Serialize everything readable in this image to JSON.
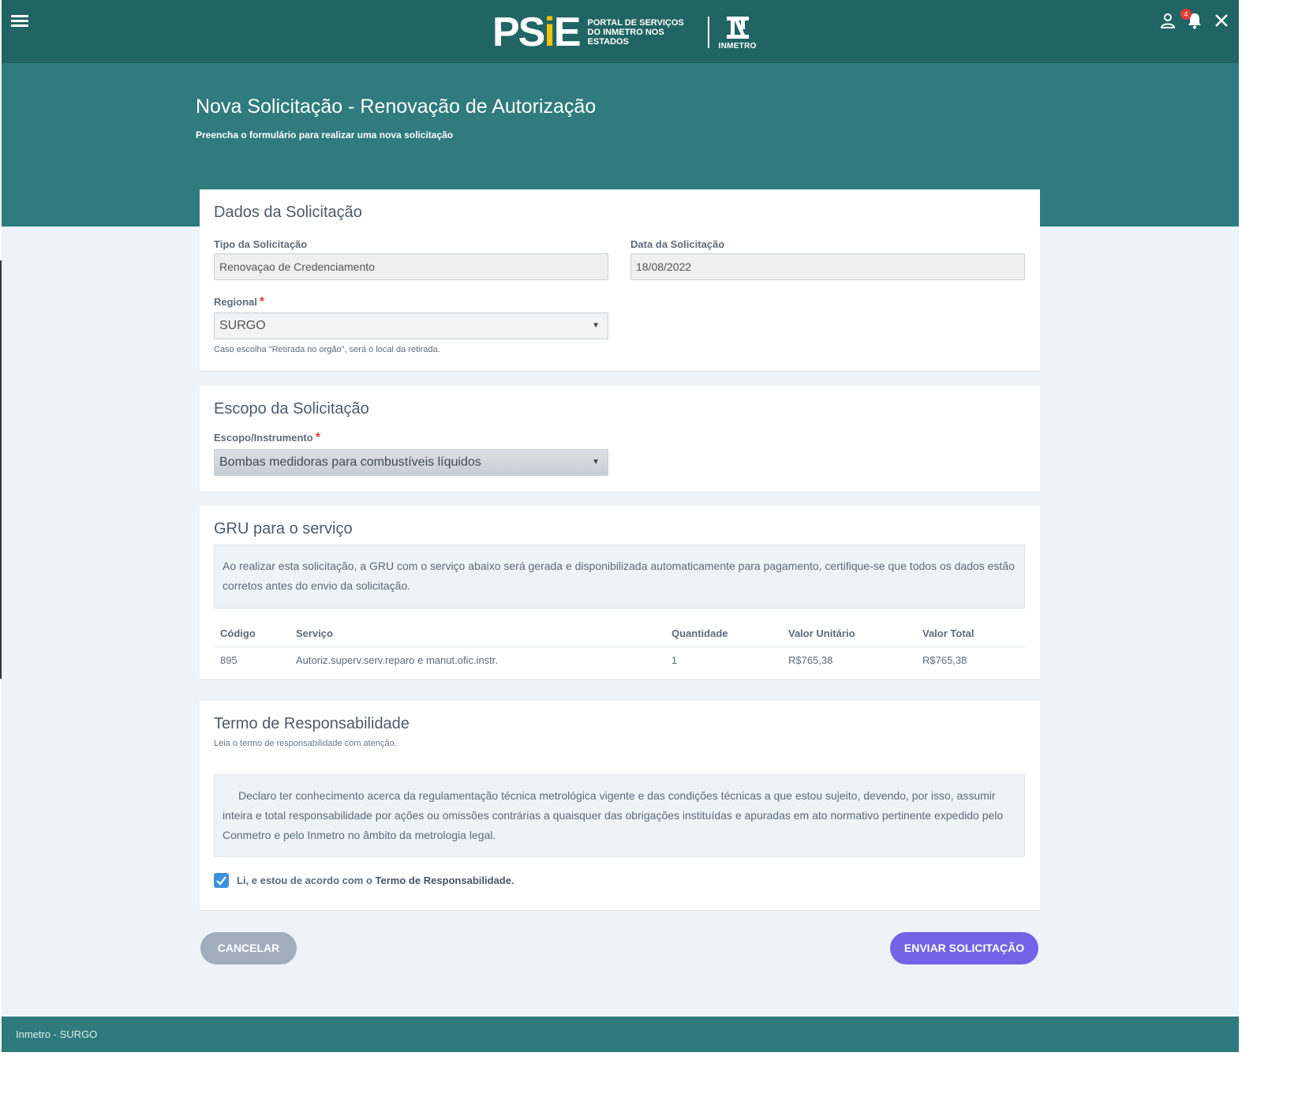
{
  "header": {
    "brand": {
      "ps": "PS",
      "s": "",
      "i": "i",
      "e": "E",
      "description_line1": "PORTAL DE SERVIÇOS",
      "description_line2": "DO INMETRO NOS ESTADOS",
      "inmetro": "INMETRO"
    },
    "icons": [
      "menu-icon",
      "user-icon",
      "bell-icon",
      "close-icon"
    ],
    "notification_count": "4"
  },
  "hero": {
    "title": "Nova Solicitação - Renovação de Autorização",
    "subtitle": "Preencha o formulário para realizar uma nova solicitação"
  },
  "dados": {
    "title": "Dados da Solicitação",
    "tipo_label": "Tipo da Solicitação",
    "tipo_value": "Renovaçao de Credenciamento",
    "data_label": "Data da Solicitação",
    "data_value": "18/08/2022",
    "regional_label": "Regional",
    "regional_required": "*",
    "regional_value": "SURGO",
    "regional_hint": "Caso escolha \"Retirada no orgão\", será o local da retirada."
  },
  "escopo": {
    "title": "Escopo da Solicitação",
    "label": "Escopo/Instrumento",
    "required": "*",
    "value": "Bombas medidoras para combustíveis líquidos"
  },
  "gru": {
    "title": "GRU para o serviço",
    "info": "Ao realizar esta solicitação, a GRU com o serviço abaixo será gerada e disponibilizada automaticamente para pagamento, certifique-se que todos os dados estão corretos antes do envio da solicitação.",
    "columns": [
      "Código",
      "Serviço",
      "Quantidade",
      "Valor Unitário",
      "Valor Total"
    ],
    "rows": [
      [
        "895",
        "Autoriz.superv.serv.reparo e manut.ofic.instr.",
        "1",
        "R$765,38",
        "R$765,38"
      ]
    ]
  },
  "termo": {
    "title": "Termo de Responsabilidade",
    "subtitle": "Leia o termo de responsabilidade com atenção.",
    "text": "Declaro ter conhecimento acerca da regulamentação técnica metrológica vigente e das condições técnicas a que estou sujeito, devendo, por isso, assumir inteira e total responsabilidade por ações ou omissões contrárias a quaisquer das obrigações instituídas e apuradas em ato normativo pertinente expedido pelo Conmetro e pelo Inmetro no âmbito da metrologia legal.",
    "checkbox_prefix": "Li, e estou de acordo com o ",
    "checkbox_bold": "Termo de Responsabilidade",
    "checkbox_suffix": ".",
    "checked": true
  },
  "actions": {
    "cancel": "CANCELAR",
    "send": "ENVIAR SOLICITAÇÃO"
  },
  "footer": {
    "text": "Inmetro - SURGO"
  },
  "colors": {
    "topbar": "#216464",
    "hero": "#2f7b7d",
    "send_button": "#7163e6",
    "cancel_button": "#a1adbd",
    "checkbox": "#3d92dd"
  }
}
